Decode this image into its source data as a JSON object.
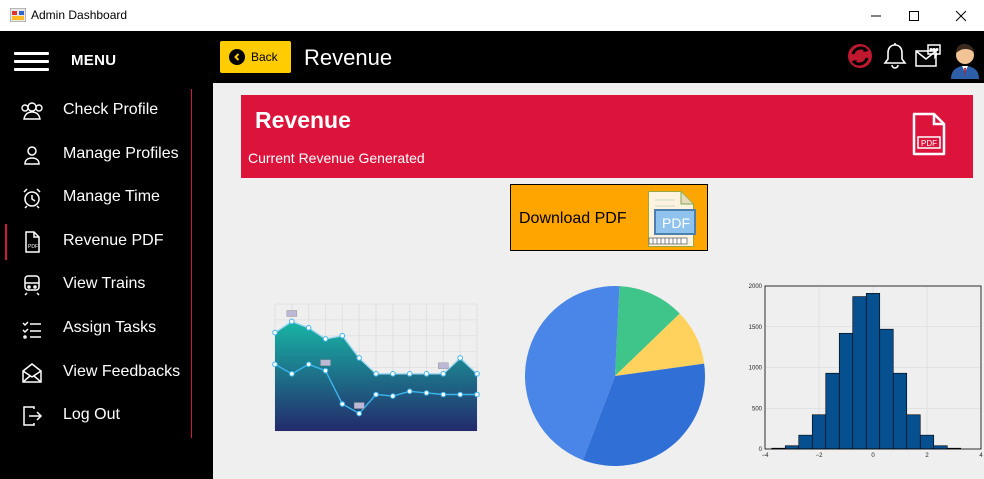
{
  "window": {
    "title": "Admin Dashboard",
    "controls": {
      "minimize": "—",
      "maximize": "☐",
      "close": "✕"
    }
  },
  "sidebar": {
    "menu_label": "MENU",
    "items": [
      {
        "label": "Check Profile",
        "icon": "users-icon"
      },
      {
        "label": "Manage Profiles",
        "icon": "user-icon"
      },
      {
        "label": "Manage Time",
        "icon": "alarm-clock-icon"
      },
      {
        "label": "Revenue PDF",
        "icon": "pdf-file-icon",
        "active": true
      },
      {
        "label": "View Trains",
        "icon": "train-icon"
      },
      {
        "label": "Assign Tasks",
        "icon": "checklist-icon"
      },
      {
        "label": "View Feedbacks",
        "icon": "mail-open-icon"
      },
      {
        "label": "Log Out",
        "icon": "logout-icon"
      }
    ]
  },
  "topbar": {
    "back_label": "Back",
    "page_title": "Revenue"
  },
  "banner": {
    "title": "Revenue",
    "subtitle": "Current Revenue Generated",
    "icon_text": "PDF"
  },
  "download": {
    "label": "Download PDF",
    "icon_text": "PDF"
  },
  "colors": {
    "accent_red": "#dc143c",
    "accent_yellow": "#ffcc00",
    "download_orange": "#ffa500"
  },
  "chart_data": [
    {
      "type": "area",
      "series": [
        {
          "values": [
            6.2,
            6.9,
            6.5,
            5.8,
            6.0,
            4.6,
            3.6,
            3.6,
            3.6,
            3.6,
            3.6,
            4.6,
            3.6
          ]
        },
        {
          "values": [
            4.2,
            3.6,
            4.2,
            3.8,
            1.7,
            1.1,
            2.3,
            2.2,
            2.5,
            2.4,
            2.3,
            2.3,
            2.3
          ]
        }
      ]
    },
    {
      "type": "pie",
      "slices": [
        {
          "value": 45,
          "color": "#4a86e8"
        },
        {
          "value": 33,
          "color": "#2f6fd6"
        },
        {
          "value": 10,
          "color": "#ffd25e"
        },
        {
          "value": 12,
          "color": "#3fc58a"
        }
      ]
    },
    {
      "type": "histogram",
      "xlim": [
        -4,
        4
      ],
      "ylim": [
        0,
        2000
      ],
      "xticks": [
        "-4",
        "-2",
        "0",
        "2",
        "4"
      ],
      "yticks": [
        "0",
        "500",
        "1000",
        "1500",
        "2000"
      ],
      "bins": [
        -3.5,
        -3.0,
        -2.5,
        -2.0,
        -1.5,
        -1.0,
        -0.5,
        0.0,
        0.5,
        1.0,
        1.5,
        2.0,
        2.5,
        3.0
      ],
      "counts": [
        10,
        40,
        170,
        420,
        930,
        1420,
        1870,
        1910,
        1470,
        930,
        420,
        170,
        40,
        10
      ],
      "bar_color": "#06508f"
    }
  ]
}
